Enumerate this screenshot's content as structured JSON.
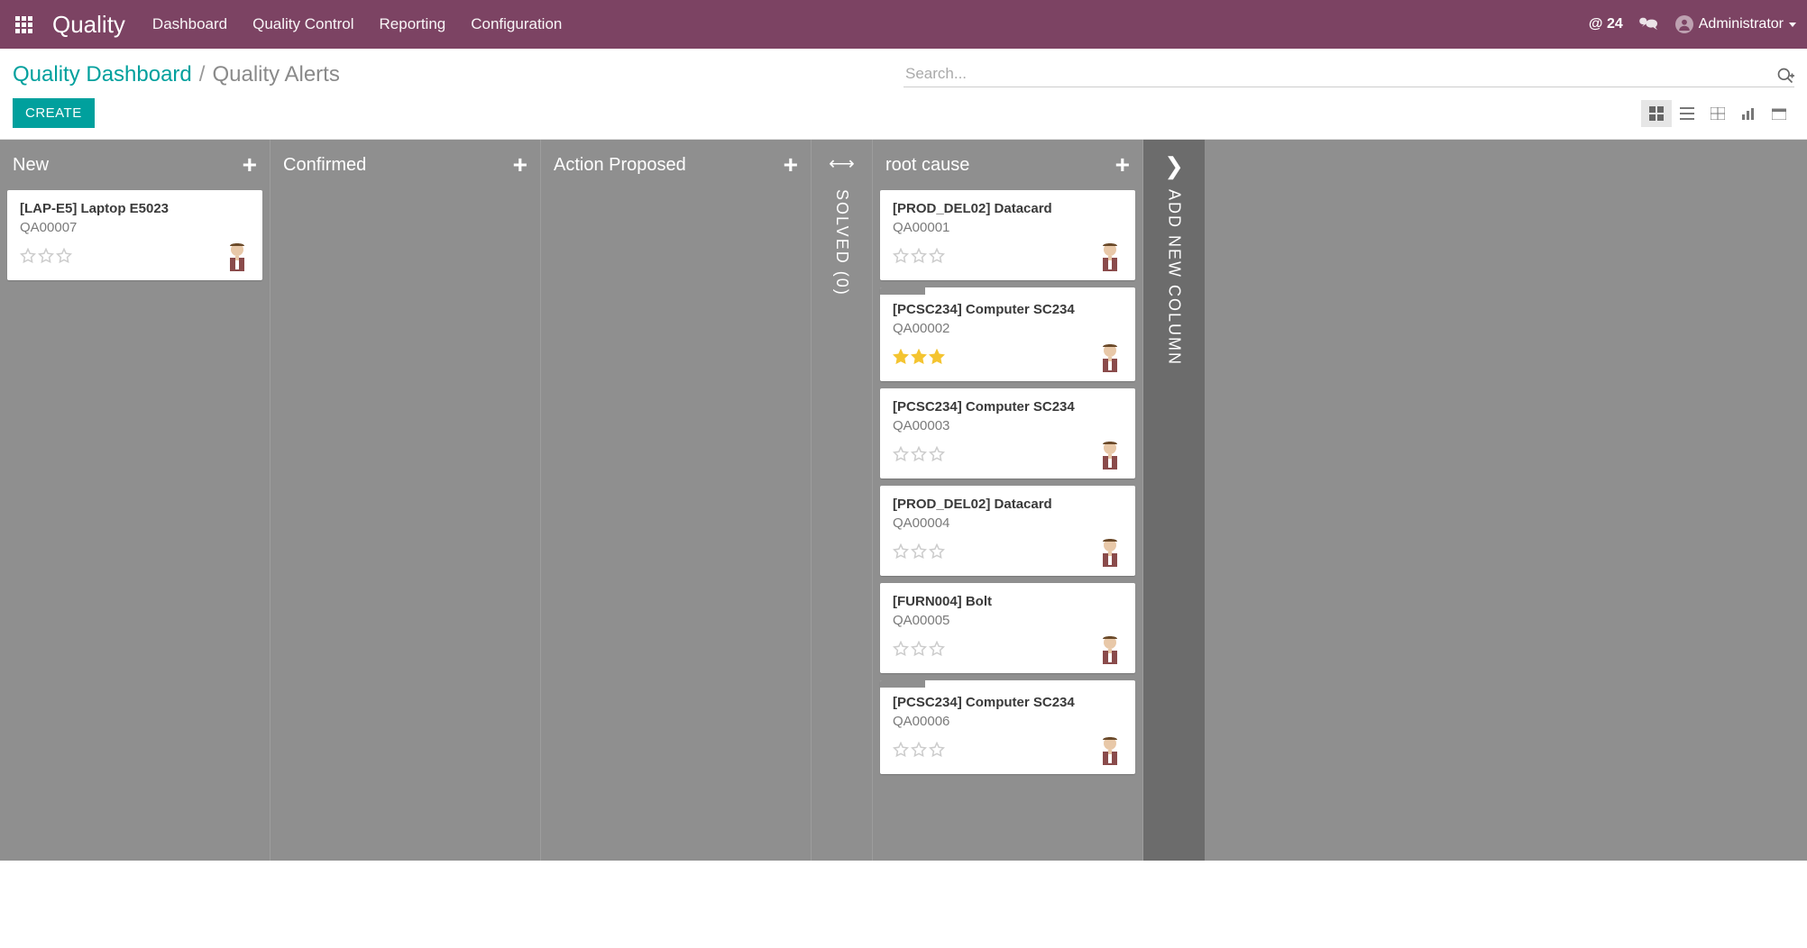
{
  "header": {
    "brand": "Quality",
    "nav": {
      "dashboard": "Dashboard",
      "quality_control": "Quality Control",
      "reporting": "Reporting",
      "configuration": "Configuration"
    },
    "mentions": "@ 24",
    "user_name": "Administrator"
  },
  "breadcrumb": {
    "parent": "Quality Dashboard",
    "current": "Quality Alerts"
  },
  "search": {
    "placeholder": "Search..."
  },
  "buttons": {
    "create": "CREATE"
  },
  "columns": [
    {
      "id": "new",
      "title": "New",
      "folded": false,
      "cards": [
        {
          "title": "[LAP-E5] Laptop E5023",
          "ref": "QA00007",
          "stars": 0,
          "progress": false
        }
      ]
    },
    {
      "id": "confirmed",
      "title": "Confirmed",
      "folded": false,
      "cards": []
    },
    {
      "id": "action_proposed",
      "title": "Action Proposed",
      "folded": false,
      "cards": []
    },
    {
      "id": "solved",
      "title": "SOLVED (0)",
      "folded": true,
      "cards": []
    },
    {
      "id": "root_cause",
      "title": "root cause",
      "folded": false,
      "cards": [
        {
          "title": "[PROD_DEL02] Datacard",
          "ref": "QA00001",
          "stars": 0,
          "progress": false
        },
        {
          "title": "[PCSC234] Computer SC234",
          "ref": "QA00002",
          "stars": 3,
          "progress": true
        },
        {
          "title": "[PCSC234] Computer SC234",
          "ref": "QA00003",
          "stars": 0,
          "progress": false
        },
        {
          "title": "[PROD_DEL02] Datacard",
          "ref": "QA00004",
          "stars": 0,
          "progress": false
        },
        {
          "title": "[FURN004] Bolt",
          "ref": "QA00005",
          "stars": 0,
          "progress": false
        },
        {
          "title": "[PCSC234] Computer SC234",
          "ref": "QA00006",
          "stars": 0,
          "progress": true
        }
      ]
    }
  ],
  "add_column_label": "ADD NEW COLUMN"
}
